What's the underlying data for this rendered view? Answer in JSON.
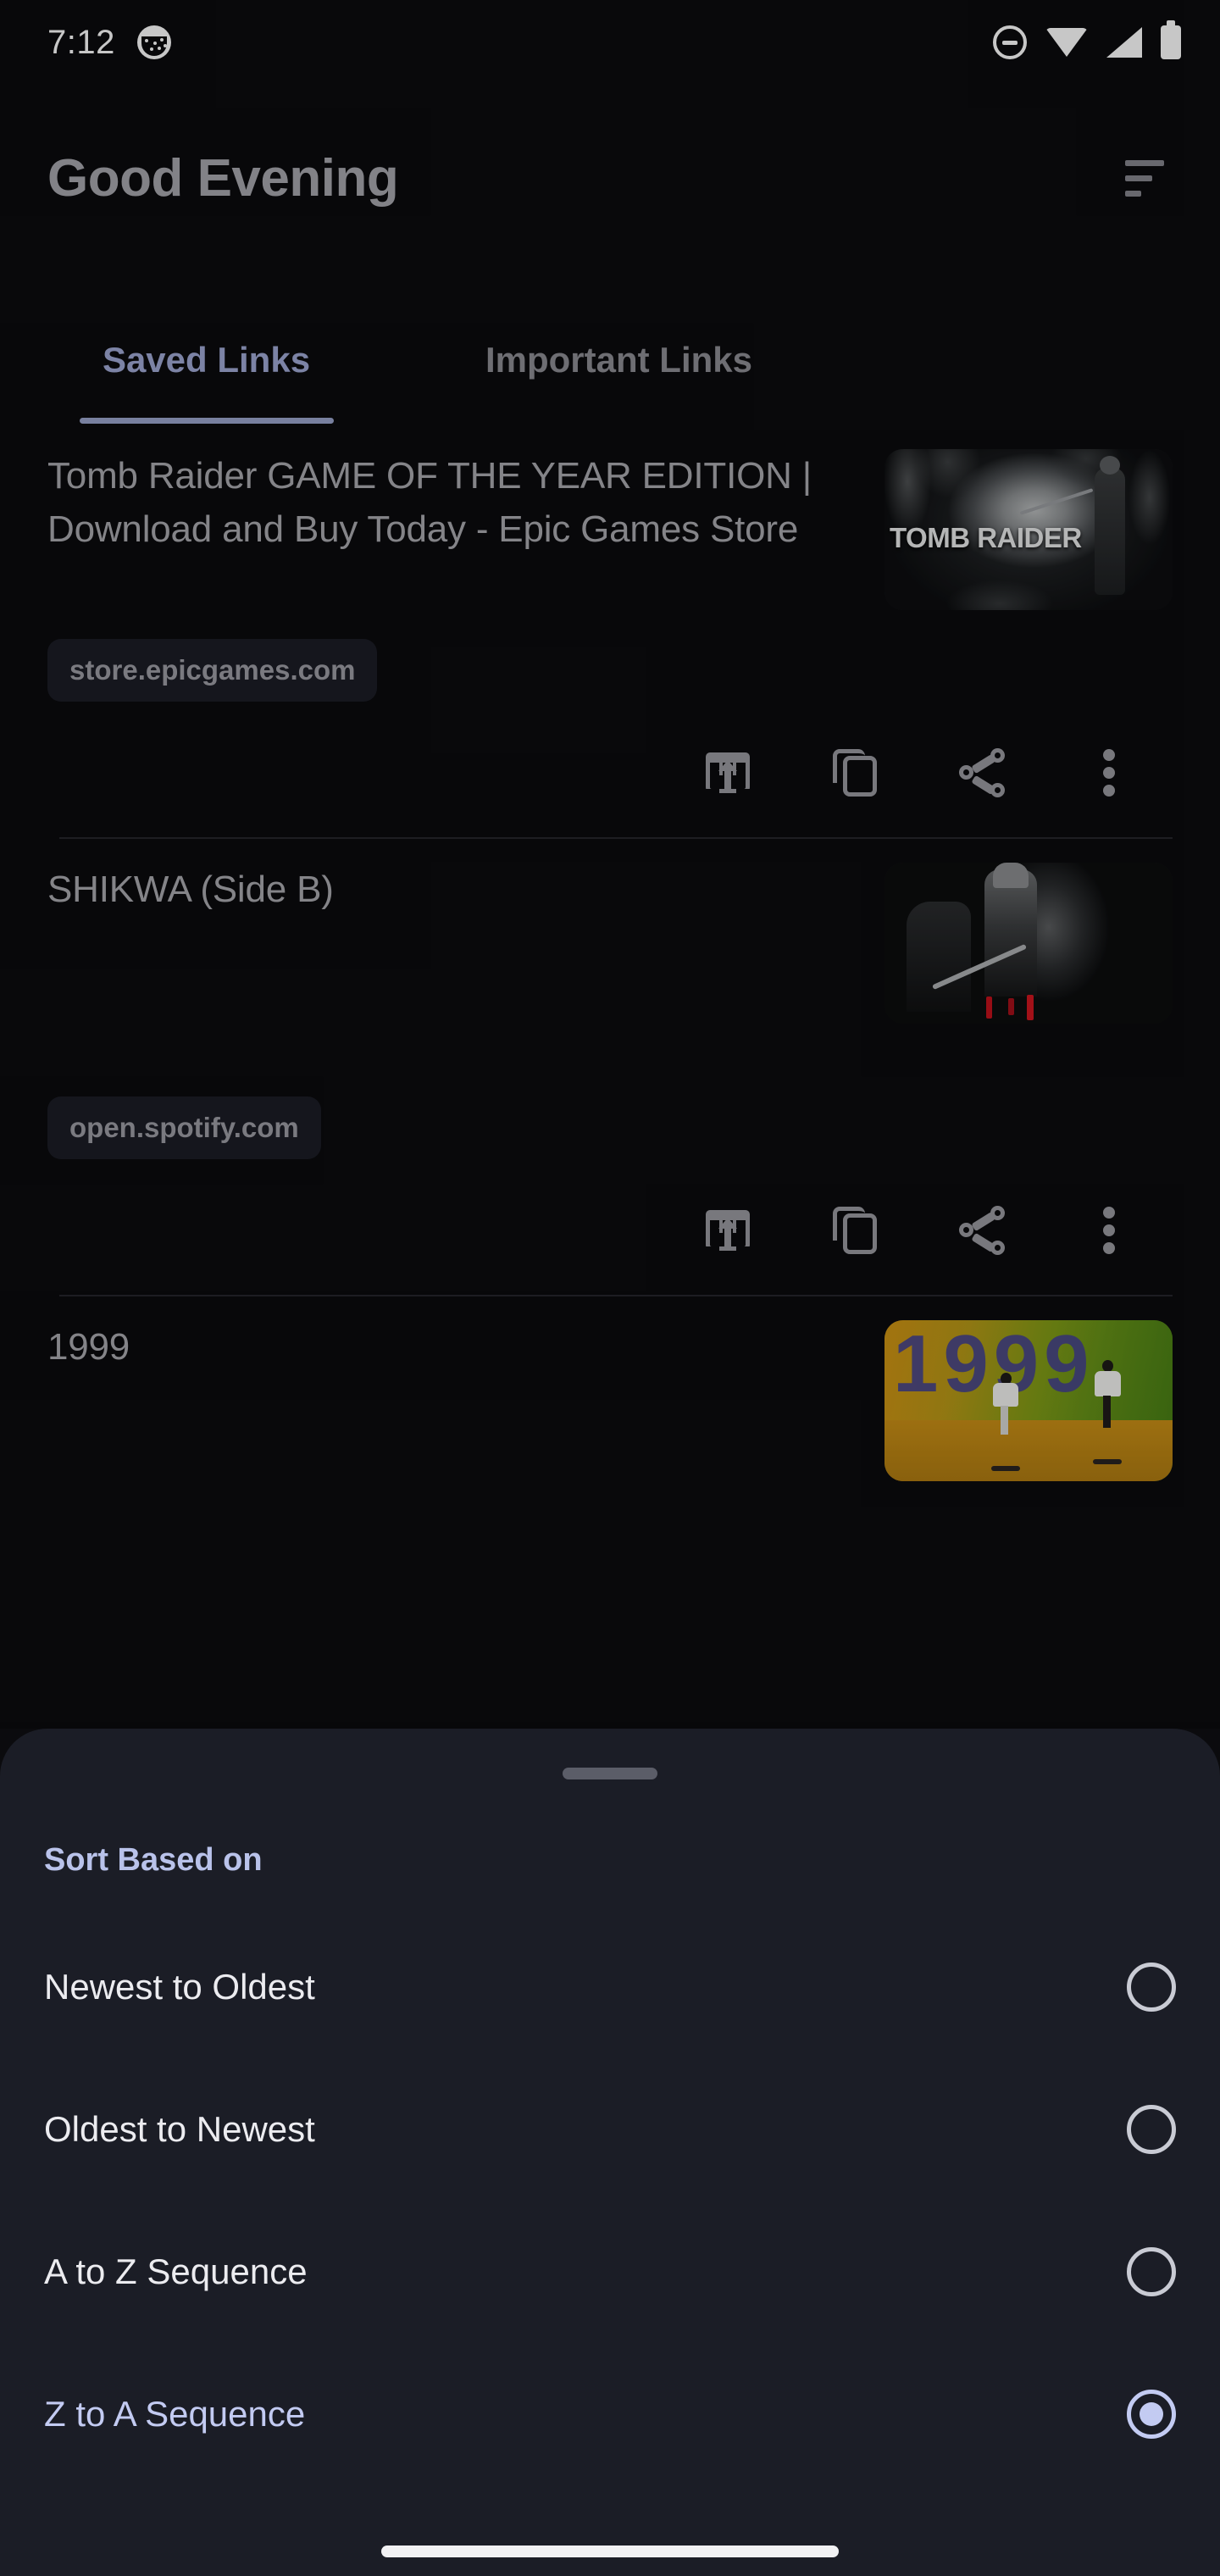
{
  "status_bar": {
    "time": "7:12",
    "icons": [
      "app-notification-icon",
      "do-not-disturb-icon",
      "wifi-icon",
      "cellular-signal-icon",
      "battery-icon"
    ]
  },
  "header": {
    "greeting": "Good Evening",
    "sort_icon": "sort-filter-icon"
  },
  "tabs": [
    {
      "label": "Saved Links",
      "active": true
    },
    {
      "label": "Important Links",
      "active": false
    }
  ],
  "links": [
    {
      "title": "Tomb Raider GAME OF THE YEAR EDITION | Download and Buy Today - Epic Games Store",
      "domain": "store.epicgames.com",
      "thumbnail_text": "TOMB RAIDER",
      "actions": [
        "open-in-browser-icon",
        "copy-icon",
        "share-icon",
        "more-options-icon"
      ]
    },
    {
      "title": "SHIKWA (Side B)",
      "domain": "open.spotify.com",
      "thumbnail_text": "",
      "actions": [
        "open-in-browser-icon",
        "copy-icon",
        "share-icon",
        "more-options-icon"
      ]
    },
    {
      "title": "1999",
      "domain": "",
      "thumbnail_text": "1999",
      "actions": []
    }
  ],
  "sort_sheet": {
    "title": "Sort Based on",
    "options": [
      {
        "label": "Newest to Oldest",
        "selected": false
      },
      {
        "label": "Oldest to Newest",
        "selected": false
      },
      {
        "label": "A to Z Sequence",
        "selected": false
      },
      {
        "label": "Z to A Sequence",
        "selected": true
      }
    ]
  },
  "colors": {
    "page_background": "#0b0b0e",
    "sheet_background": "#1b1d26",
    "accent": "#9fa8d4",
    "accent_selected": "#c3cbf2",
    "primary_text": "#a9a9af",
    "muted_text": "#8d8d94"
  }
}
